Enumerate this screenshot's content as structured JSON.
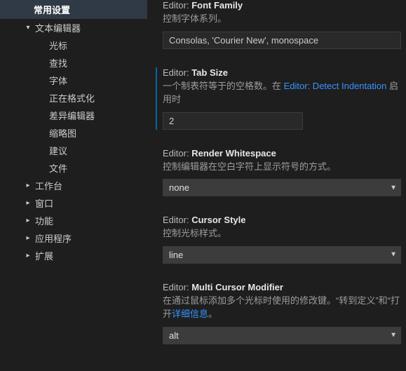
{
  "sidebar": {
    "header": "常用设置",
    "groups": [
      {
        "label": "文本编辑器",
        "expanded": true,
        "children": [
          {
            "label": "光标"
          },
          {
            "label": "查找"
          },
          {
            "label": "字体"
          },
          {
            "label": "正在格式化"
          },
          {
            "label": "差异编辑器"
          },
          {
            "label": "缩略图"
          },
          {
            "label": "建议"
          },
          {
            "label": "文件"
          }
        ]
      },
      {
        "label": "工作台",
        "expanded": false
      },
      {
        "label": "窗口",
        "expanded": false
      },
      {
        "label": "功能",
        "expanded": false
      },
      {
        "label": "应用程序",
        "expanded": false
      },
      {
        "label": "扩展",
        "expanded": false
      }
    ]
  },
  "settings": {
    "fontFamily": {
      "category": "Editor:",
      "name": "Font Family",
      "desc": "控制字体系列。",
      "value": "Consolas, 'Courier New', monospace",
      "modified": false
    },
    "tabSize": {
      "category": "Editor:",
      "name": "Tab Size",
      "desc_pre": "一个制表符等于的空格数。在 ",
      "desc_link": "Editor: Detect Indentation",
      "desc_post": " 启用时",
      "value": "2",
      "modified": true
    },
    "renderWhitespace": {
      "category": "Editor:",
      "name": "Render Whitespace",
      "desc": "控制编辑器在空白字符上显示符号的方式。",
      "value": "none",
      "modified": false
    },
    "cursorStyle": {
      "category": "Editor:",
      "name": "Cursor Style",
      "desc": "控制光标样式。",
      "value": "line",
      "modified": false
    },
    "multiCursorModifier": {
      "category": "Editor:",
      "name": "Multi Cursor Modifier",
      "desc_pre": "在通过鼠标添加多个光标时使用的修改键。“转到定义”和“打开",
      "desc_link": "详细信息",
      "desc_post": "。",
      "value": "alt",
      "modified": false
    }
  }
}
